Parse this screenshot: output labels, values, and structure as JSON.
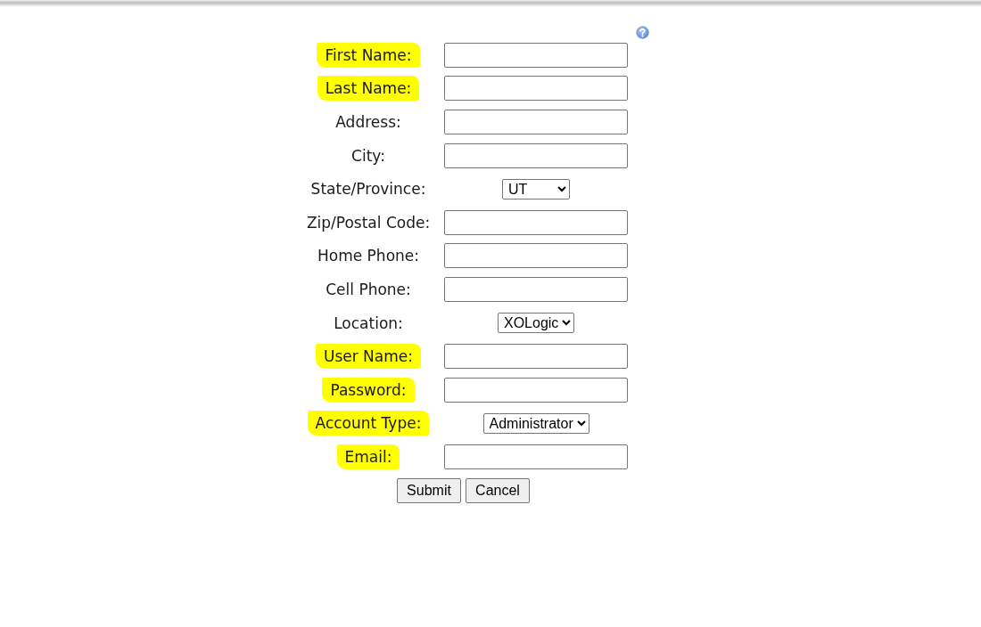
{
  "fields": [
    {
      "label": "First Name:",
      "kind": "text",
      "highlighted": true
    },
    {
      "label": "Last Name:",
      "kind": "text",
      "highlighted": true
    },
    {
      "label": "Address:",
      "kind": "text",
      "highlighted": false
    },
    {
      "label": "City:",
      "kind": "text",
      "highlighted": false
    },
    {
      "label": "State/Province:",
      "kind": "select",
      "value": "UT",
      "highlighted": false
    },
    {
      "label": "Zip/Postal Code:",
      "kind": "text",
      "highlighted": false
    },
    {
      "label": "Home Phone:",
      "kind": "text",
      "highlighted": false
    },
    {
      "label": "Cell Phone:",
      "kind": "text",
      "highlighted": false
    },
    {
      "label": "Location:",
      "kind": "select",
      "value": "XOLogic",
      "highlighted": false
    },
    {
      "label": "User Name:",
      "kind": "text",
      "highlighted": true
    },
    {
      "label": "Password:",
      "kind": "text",
      "highlighted": true
    },
    {
      "label": "Account Type:",
      "kind": "select",
      "value": "Administrator",
      "highlighted": true
    },
    {
      "label": "Email:",
      "kind": "text",
      "highlighted": true
    }
  ],
  "buttons": [
    "Submit",
    "Cancel"
  ]
}
